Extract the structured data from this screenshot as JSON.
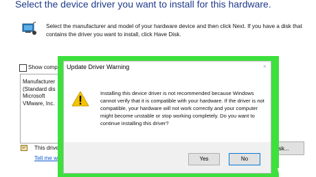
{
  "page": {
    "heading": "Select the device driver you want to install for this hardware.",
    "instructions": "Select the manufacturer and model of your hardware device and then click Next. If you have a disk that contains the driver you want to install, click Have Disk.",
    "show_compatible_label": "Show comp",
    "show_compatible_checked": false,
    "manufacturers": [
      "Manufacturer",
      "(Standard dis",
      "Microsoft",
      "VMware, Inc."
    ],
    "signed_text": "This drive",
    "tell_me_link": "Tell me wh",
    "have_disk_label": "Disk..."
  },
  "dialog": {
    "title": "Update Driver Warning",
    "close_glyph": "×",
    "message": "Installing this device driver is not recommended because Windows cannot verify that it is compatible with your hardware.  If the driver is not compatible, your hardware will not work correctly and your computer might become unstable or stop working completely.  Do you want to continue installing this driver?",
    "yes_label": "Yes",
    "no_label": "No"
  },
  "watermark": {
    "wiki": "wiki",
    "how": "How"
  },
  "colors": {
    "highlight": "#3de03d",
    "heading": "#1e3a8a",
    "link": "#0b57d0",
    "warning": "#f5c400"
  }
}
